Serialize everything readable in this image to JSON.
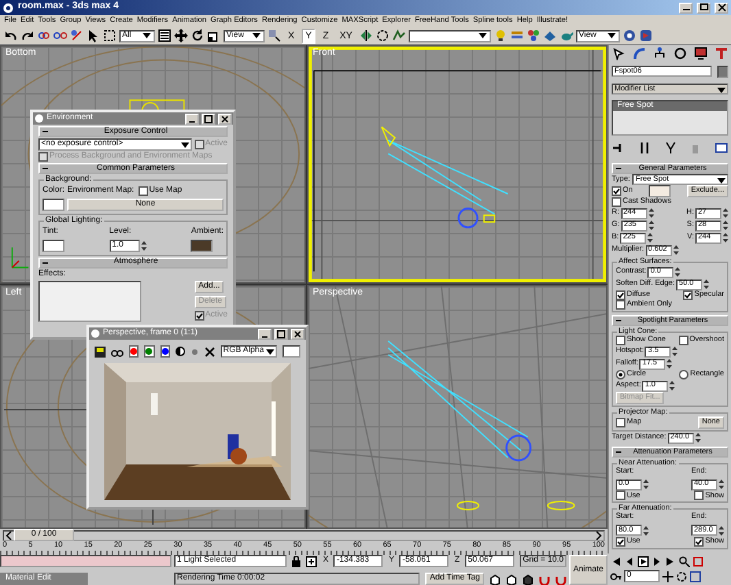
{
  "window": {
    "title": "room.max - 3ds max 4"
  },
  "menu": [
    "File",
    "Edit",
    "Tools",
    "Group",
    "Views",
    "Create",
    "Modifiers",
    "Animation",
    "Graph Editors",
    "Rendering",
    "Customize",
    "MAXScript",
    "Explorer",
    "FreeHand Tools",
    "Spline tools",
    "Help",
    "Illustrate!"
  ],
  "toolbar": {
    "selection_filter": "All",
    "reference_coord": "View",
    "axes": [
      {
        "label": "X",
        "selected": false
      },
      {
        "label": "Y",
        "selected": true
      },
      {
        "label": "Z",
        "selected": false
      },
      {
        "label": "XY",
        "selected": false
      }
    ],
    "render_type": "View"
  },
  "viewports": [
    {
      "label": "Bottom",
      "active": false
    },
    {
      "label": "Front",
      "active": true
    },
    {
      "label": "Left",
      "active": false
    },
    {
      "label": "Perspective",
      "active": false
    }
  ],
  "environment": {
    "title": "Environment",
    "rollouts": [
      {
        "title": "Exposure Control",
        "rows": [
          [
            {
              "kind": "dropdown",
              "value": "<no exposure control>"
            },
            {
              "kind": "check",
              "text": "Active",
              "checked": false,
              "disabled": true
            }
          ],
          [
            {
              "kind": "check",
              "text": "Process Background and Environment Maps",
              "checked": false,
              "disabled": true
            }
          ]
        ]
      },
      {
        "title": "Common Parameters",
        "rows": [
          {
            "kind": "group",
            "title": "Background:",
            "rows": [
              [
                {
                  "kind": "stack",
                  "items": [
                    {
                      "kind": "label",
                      "text": "Color:"
                    },
                    {
                      "kind": "swatch",
                      "color": "#ffffff"
                    }
                  ]
                },
                {
                  "kind": "stack",
                  "items": [
                    {
                      "kind": "line",
                      "items": [
                        {
                          "kind": "label",
                          "text": "Environment Map:"
                        },
                        {
                          "kind": "check",
                          "text": "Use Map",
                          "checked": false,
                          "disabled": false
                        }
                      ]
                    },
                    {
                      "kind": "button",
                      "text": "None",
                      "disabled": false
                    }
                  ]
                }
              ]
            ]
          },
          {
            "kind": "group",
            "title": "Global Lighting:",
            "rows": [
              [
                {
                  "kind": "stack",
                  "items": [
                    {
                      "kind": "label",
                      "text": "Tint:"
                    },
                    {
                      "kind": "swatch",
                      "color": "#ffffff"
                    }
                  ]
                },
                {
                  "kind": "stack",
                  "items": [
                    {
                      "kind": "label",
                      "text": "Level:"
                    },
                    {
                      "kind": "spinner",
                      "value": "1.0"
                    }
                  ]
                },
                {
                  "kind": "stack",
                  "items": [
                    {
                      "kind": "label",
                      "text": "Ambient:"
                    },
                    {
                      "kind": "swatch",
                      "color": "#4b3a28"
                    }
                  ]
                }
              ]
            ]
          }
        ]
      },
      {
        "title": "Atmosphere",
        "rows": [
          [
            {
              "kind": "label",
              "text": "Effects:"
            }
          ],
          [
            {
              "kind": "listbox"
            },
            {
              "kind": "stack",
              "items": [
                {
                  "kind": "button",
                  "text": "Add...",
                  "disabled": false
                },
                {
                  "kind": "button",
                  "text": "Delete",
                  "disabled": true
                },
                {
                  "kind": "check",
                  "text": "Active",
                  "checked": true,
                  "disabled": true
                }
              ]
            }
          ]
        ]
      }
    ]
  },
  "render_window": {
    "title": "Perspective, frame 0 (1:1)",
    "channels": [
      {
        "color": "#ff0000",
        "on": true
      },
      {
        "color": "#008000",
        "on": true
      },
      {
        "color": "#0000ff",
        "on": true
      }
    ],
    "display": "RGB Alpha"
  },
  "command_panel": {
    "object_name": "Fspot06",
    "modifier_list": "Modifier List",
    "stack": [
      {
        "label": "Free Spot",
        "selected": true
      }
    ],
    "rollouts": [
      {
        "title": "General Parameters",
        "rows": [
          [
            {
              "kind": "label",
              "text": "Type:"
            },
            {
              "kind": "dropdown",
              "value": "Free Spot"
            }
          ],
          [
            {
              "kind": "check",
              "text": "On",
              "checked": true,
              "disabled": false
            },
            {
              "kind": "swatch",
              "color": "#f4ebe1"
            },
            {
              "kind": "button",
              "text": "Exclude...",
              "disabled": false
            }
          ],
          [
            {
              "kind": "check",
              "text": "Cast Shadows",
              "checked": false,
              "disabled": false
            }
          ],
          [
            {
              "kind": "spinner",
              "label": "R:",
              "value": "244"
            },
            {
              "kind": "spinner",
              "label": "H:",
              "value": "27"
            }
          ],
          [
            {
              "kind": "spinner",
              "label": "G:",
              "value": "235"
            },
            {
              "kind": "spinner",
              "label": "S:",
              "value": "28"
            }
          ],
          [
            {
              "kind": "spinner",
              "label": "B:",
              "value": "225"
            },
            {
              "kind": "spinner",
              "label": "V:",
              "value": "244"
            }
          ],
          [
            {
              "kind": "spinner",
              "label": "Multiplier:",
              "value": "0.602"
            }
          ],
          {
            "kind": "group",
            "title": "Affect Surfaces:",
            "rows": [
              [
                {
                  "kind": "spinner",
                  "label": "Contrast:",
                  "value": "0.0"
                }
              ],
              [
                {
                  "kind": "spinner",
                  "label": "Soften Diff. Edge:",
                  "value": "50.0"
                }
              ],
              [
                {
                  "kind": "check",
                  "text": "Diffuse",
                  "checked": true,
                  "disabled": false
                },
                {
                  "kind": "check",
                  "text": "Specular",
                  "checked": true,
                  "disabled": false
                }
              ],
              [
                {
                  "kind": "check",
                  "text": "Ambient Only",
                  "checked": false,
                  "disabled": false
                }
              ]
            ]
          }
        ]
      },
      {
        "title": "Spotlight Parameters",
        "rows": [
          {
            "kind": "group",
            "title": "Light Cone:",
            "rows": [
              [
                {
                  "kind": "check",
                  "text": "Show Cone",
                  "checked": false,
                  "disabled": false
                },
                {
                  "kind": "check",
                  "text": "Overshoot",
                  "checked": false,
                  "disabled": false
                }
              ],
              [
                {
                  "kind": "spinner",
                  "label": "Hotspot:",
                  "value": "3.5"
                }
              ],
              [
                {
                  "kind": "spinner",
                  "label": "Falloff:",
                  "value": "17.5"
                }
              ],
              [
                {
                  "kind": "radio",
                  "text": "Circle",
                  "selected": true
                },
                {
                  "kind": "radio",
                  "text": "Rectangle",
                  "selected": false
                }
              ],
              [
                {
                  "kind": "spinner",
                  "label": "Aspect:",
                  "value": "1.0"
                }
              ],
              [
                {
                  "kind": "button",
                  "text": "Bitmap Fit...",
                  "disabled": true
                }
              ]
            ]
          },
          {
            "kind": "group",
            "title": "Projector Map:",
            "rows": [
              [
                {
                  "kind": "check",
                  "text": "Map",
                  "checked": false,
                  "disabled": false
                },
                {
                  "kind": "button",
                  "text": "None",
                  "disabled": false
                }
              ]
            ]
          },
          [
            {
              "kind": "spinner",
              "label": "Target Distance:",
              "value": "240.0"
            }
          ]
        ]
      },
      {
        "title": "Attenuation Parameters",
        "rows": [
          {
            "kind": "group",
            "title": "Near Attenuation:",
            "rows": [
              [
                {
                  "kind": "stack",
                  "items": [
                    {
                      "kind": "label",
                      "text": "Start:"
                    },
                    {
                      "kind": "spinner",
                      "value": "0.0"
                    }
                  ]
                },
                {
                  "kind": "stack",
                  "items": [
                    {
                      "kind": "label",
                      "text": "End:"
                    },
                    {
                      "kind": "spinner",
                      "value": "40.0"
                    }
                  ]
                }
              ],
              [
                {
                  "kind": "check",
                  "text": "Use",
                  "checked": false,
                  "disabled": false
                },
                {
                  "kind": "check",
                  "text": "Show",
                  "checked": false,
                  "disabled": false
                }
              ]
            ]
          },
          {
            "kind": "group",
            "title": "Far Attenuation:",
            "rows": [
              [
                {
                  "kind": "stack",
                  "items": [
                    {
                      "kind": "label",
                      "text": "Start:"
                    },
                    {
                      "kind": "spinner",
                      "value": "80.0"
                    }
                  ]
                },
                {
                  "kind": "stack",
                  "items": [
                    {
                      "kind": "label",
                      "text": "End:"
                    },
                    {
                      "kind": "spinner",
                      "value": "289.0"
                    }
                  ]
                }
              ],
              [
                {
                  "kind": "check",
                  "text": "Use",
                  "checked": true,
                  "disabled": false
                },
                {
                  "kind": "check",
                  "text": "Show",
                  "checked": true,
                  "disabled": false
                }
              ]
            ]
          }
        ]
      }
    ]
  },
  "time_slider": {
    "position": "0 / 100",
    "level": 0
  },
  "ruler": {
    "ticks": [
      "0",
      "5",
      "10",
      "15",
      "20",
      "25",
      "30",
      "35",
      "40",
      "45",
      "50",
      "55",
      "60",
      "65",
      "70",
      "75",
      "80",
      "85",
      "90",
      "95",
      "100"
    ]
  },
  "status_bar": {
    "selection": "1 Light Selected",
    "prompt": "Rendering Time 0:00:02",
    "coords": [
      {
        "axis": "X",
        "value": "-134.383"
      },
      {
        "axis": "Y",
        "value": "-58.061"
      },
      {
        "axis": "Z",
        "value": "50.067"
      }
    ],
    "grid": "Grid = 10.0",
    "time_tag": "Add Time Tag",
    "animate": "Animate"
  },
  "minimized_window": {
    "title": "Material Edit"
  },
  "time_controls": {
    "frame": "0"
  }
}
